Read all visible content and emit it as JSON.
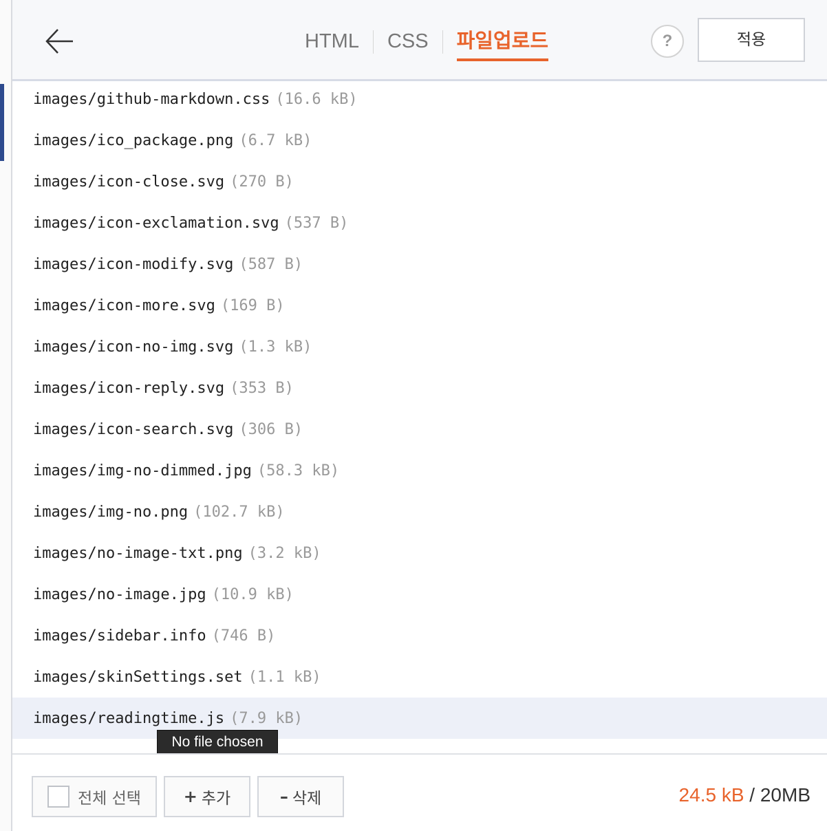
{
  "header": {
    "tabs": [
      {
        "label": "HTML",
        "active": false
      },
      {
        "label": "CSS",
        "active": false
      },
      {
        "label": "파일업로드",
        "active": true
      }
    ],
    "help_label": "?",
    "apply_label": "적용"
  },
  "files": [
    {
      "name": "images/github-markdown.css",
      "size": "(16.6 kB)"
    },
    {
      "name": "images/ico_package.png",
      "size": "(6.7 kB)"
    },
    {
      "name": "images/icon-close.svg",
      "size": "(270 B)"
    },
    {
      "name": "images/icon-exclamation.svg",
      "size": "(537 B)"
    },
    {
      "name": "images/icon-modify.svg",
      "size": "(587 B)"
    },
    {
      "name": "images/icon-more.svg",
      "size": "(169 B)"
    },
    {
      "name": "images/icon-no-img.svg",
      "size": "(1.3 kB)"
    },
    {
      "name": "images/icon-reply.svg",
      "size": "(353 B)"
    },
    {
      "name": "images/icon-search.svg",
      "size": "(306 B)"
    },
    {
      "name": "images/img-no-dimmed.jpg",
      "size": "(58.3 kB)"
    },
    {
      "name": "images/img-no.png",
      "size": "(102.7 kB)"
    },
    {
      "name": "images/no-image-txt.png",
      "size": "(3.2 kB)"
    },
    {
      "name": "images/no-image.jpg",
      "size": "(10.9 kB)"
    },
    {
      "name": "images/sidebar.info",
      "size": "(746 B)"
    },
    {
      "name": "images/skinSettings.set",
      "size": "(1.1 kB)"
    },
    {
      "name": "images/readingtime.js",
      "size": "(7.9 kB)",
      "selected": true
    }
  ],
  "tooltip": "No file chosen",
  "footer": {
    "select_all_label": "전체 선택",
    "add_glyph": "+",
    "add_label": "추가",
    "delete_glyph": "–",
    "delete_label": "삭제",
    "used": "24.5 kB",
    "separator": "/",
    "limit": "20MB"
  },
  "colors": {
    "accent": "#e8632b",
    "selected_row": "#edf0f8",
    "sidebar_blue": "#2d4a8e"
  },
  "icons": [
    "back-arrow-icon",
    "help-icon",
    "checkbox-icon",
    "plus-icon",
    "minus-icon"
  ]
}
